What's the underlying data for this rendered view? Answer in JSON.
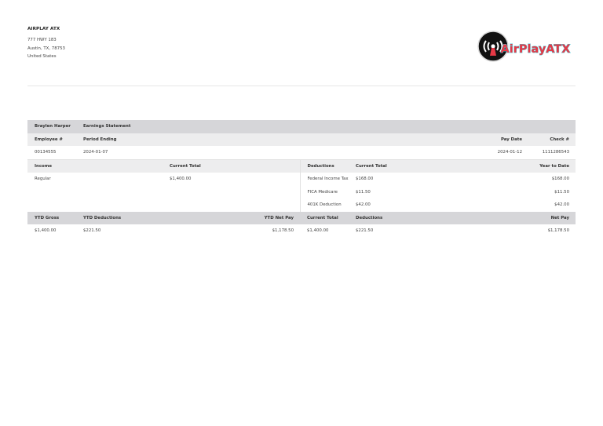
{
  "company": {
    "name": "AIRPLAY ATX",
    "address1": "777 HWY 183",
    "address2": "Austin, TX, 78753",
    "country": "United States"
  },
  "logo": {
    "text": "AirPlayATX",
    "colors": {
      "ring": "#111111",
      "accent": "#e63946",
      "outline": "#4ec9d8"
    }
  },
  "statement": {
    "employee_name": "Braylen Harper",
    "title": "Earnings Statement",
    "employee_no_label": "Employee #",
    "period_ending_label": "Period Ending",
    "pay_date_label": "Pay Date",
    "check_label": "Check #",
    "employee_no": "00134555",
    "period_ending": "2024-01-07",
    "pay_date": "2024-01-12",
    "check_no": "1111286543"
  },
  "income": {
    "headers": {
      "income": "Income",
      "current_total": "Current Total"
    },
    "rows": [
      {
        "label": "Regular",
        "amount": "$1,400.00"
      }
    ]
  },
  "deductions": {
    "headers": {
      "deductions": "Deductions",
      "current_total": "Current Total",
      "ytd": "Year to Date"
    },
    "rows": [
      {
        "label": "Federal Income Tax",
        "current": "$168.00",
        "ytd": "$168.00"
      },
      {
        "label": "FICA Medicare",
        "current": "$11.50",
        "ytd": "$11.50"
      },
      {
        "label": "401K Deduction",
        "current": "$42.00",
        "ytd": "$42.00"
      }
    ]
  },
  "totals": {
    "headers": {
      "ytd_gross": "YTD Gross",
      "ytd_deductions": "YTD Deductions",
      "ytd_net": "YTD Net Pay",
      "current_total": "Current Total",
      "deductions": "Deductions",
      "net_pay": "Net Pay"
    },
    "values": {
      "ytd_gross": "$1,400.00",
      "ytd_deductions": "$221.50",
      "ytd_net": "$1,178.50",
      "current_total": "$1,400.00",
      "deductions": "$221.50",
      "net_pay": "$1,178.50"
    }
  }
}
